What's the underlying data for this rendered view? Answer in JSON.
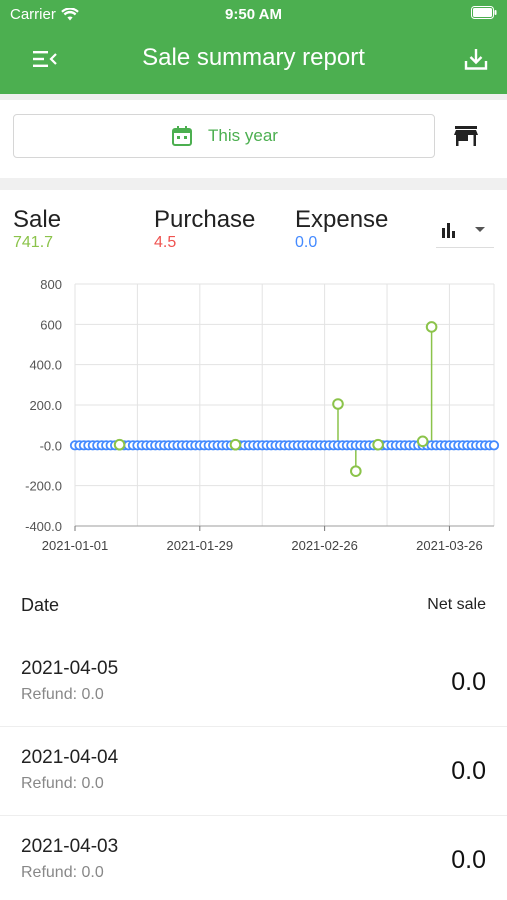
{
  "status_bar": {
    "carrier": "Carrier",
    "time": "9:50 AM"
  },
  "header": {
    "title": "Sale summary report",
    "menu_icon": "menu-collapse-icon",
    "download_icon": "download-icon"
  },
  "filter": {
    "date_range": "This year",
    "date_icon": "calendar-icon",
    "store_icon": "store-icon"
  },
  "summary": {
    "sale": {
      "label": "Sale",
      "value": "741.7",
      "color": "#8bc34a"
    },
    "purchase": {
      "label": "Purchase",
      "value": "4.5",
      "color": "#ef5350"
    },
    "expense": {
      "label": "Expense",
      "value": "0.0",
      "color": "#448aff"
    },
    "chart_type_icon": "bar-chart-icon"
  },
  "chart_data": {
    "type": "line",
    "y_tick_labels": [
      "800",
      "600",
      "400.0",
      "200.0",
      "-0.0",
      "-200.0",
      "-400.0"
    ],
    "ylim": [
      -400,
      800
    ],
    "x_tick_labels": [
      "2021-01-01",
      "2021-01-29",
      "2021-02-26",
      "2021-03-26"
    ],
    "grid": true,
    "series": [
      {
        "color": "#8bc34a",
        "points": [
          {
            "date": "2021-01-11",
            "value": 3
          },
          {
            "date": "2021-02-06",
            "value": 3
          },
          {
            "date": "2021-03-01",
            "value": 205
          },
          {
            "date": "2021-03-05",
            "value": -128
          },
          {
            "date": "2021-03-10",
            "value": 3
          },
          {
            "date": "2021-03-20",
            "value": 20
          },
          {
            "date": "2021-03-22",
            "value": 587
          }
        ]
      },
      {
        "color": "#448aff",
        "points_daily_range": [
          "2021-01-01",
          "2021-04-05"
        ],
        "value": 0
      }
    ]
  },
  "list": {
    "date_header": "Date",
    "net_header": "Net sale",
    "rows": [
      {
        "date": "2021-04-05",
        "refund": "Refund: 0.0",
        "amount": "0.0"
      },
      {
        "date": "2021-04-04",
        "refund": "Refund: 0.0",
        "amount": "0.0"
      },
      {
        "date": "2021-04-03",
        "refund": "Refund: 0.0",
        "amount": "0.0"
      }
    ]
  }
}
